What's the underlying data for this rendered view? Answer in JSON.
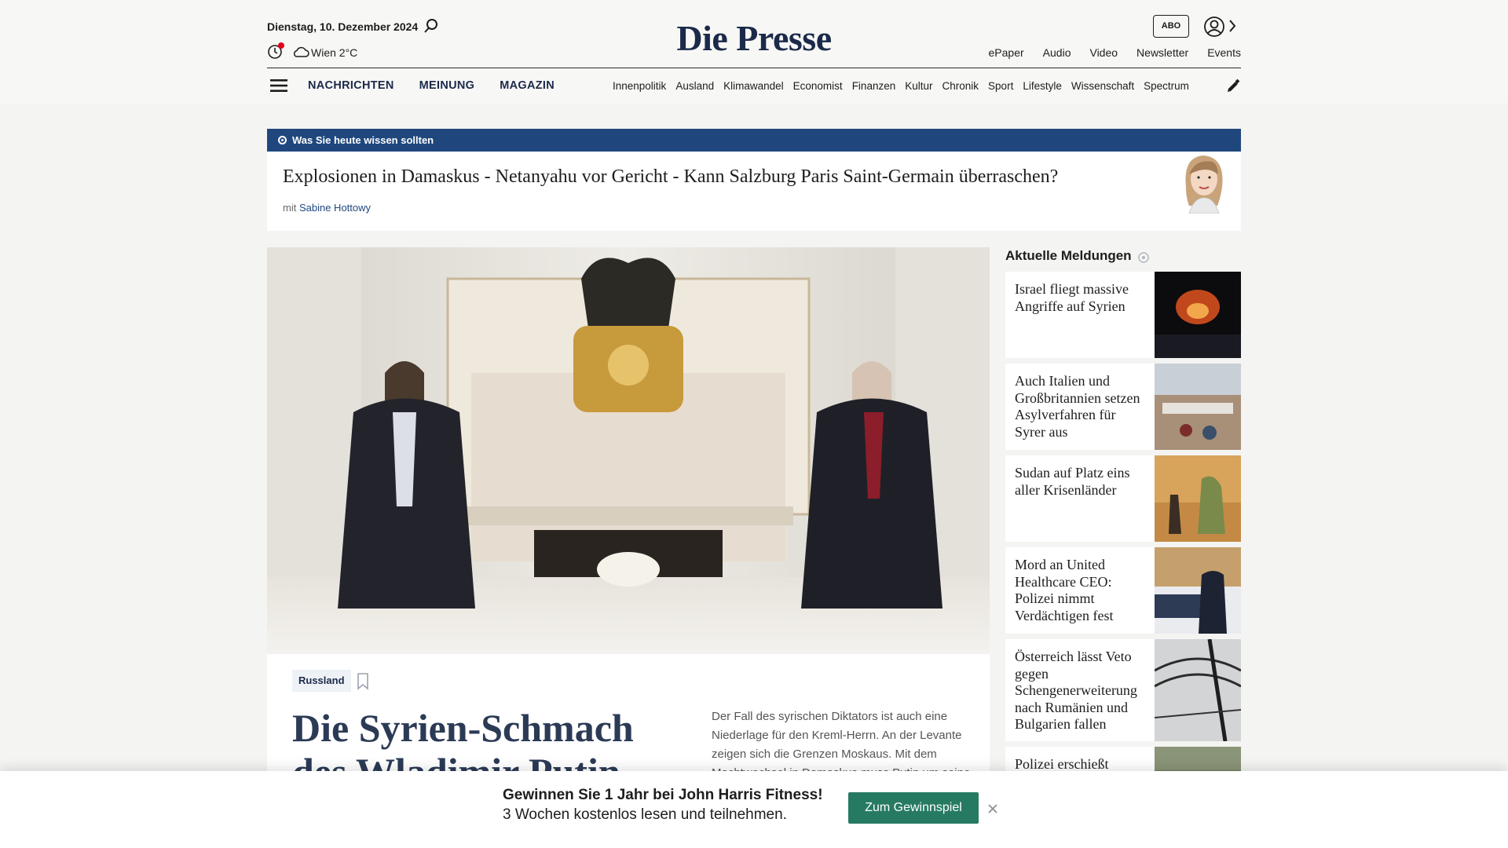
{
  "header": {
    "date": "Dienstag, 10. Dezember 2024",
    "weather": "Wien 2°C",
    "logo": "Die Presse",
    "abo_label": "ABO",
    "top_links": [
      "ePaper",
      "Audio",
      "Video",
      "Newsletter",
      "Events"
    ],
    "main_nav": [
      "NACHRICHTEN",
      "MEINUNG",
      "MAGAZIN"
    ],
    "sub_nav": [
      "Innenpolitik",
      "Ausland",
      "Klimawandel",
      "Economist",
      "Finanzen",
      "Kultur",
      "Chronik",
      "Sport",
      "Lifestyle",
      "Wissenschaft",
      "Spectrum"
    ]
  },
  "briefing": {
    "label": "Was Sie heute wissen sollten",
    "title": "Explosionen in Damaskus - Netanyahu vor Gericht - Kann Salzburg Paris Saint-Germain überraschen?",
    "by_prefix": "mit",
    "author": "Sabine Hottowy"
  },
  "hero": {
    "tag": "Russland",
    "title": "Die Syrien-Schmach des Wladimir Putin",
    "teaser": "Der Fall des syrischen Diktators ist auch eine Niederlage für den Kreml-Herrn. An der Levante zeigen sich die Grenzen Moskaus. Mit dem Machtwechsel in Damaskus muss Putin um seine Stützpunkte bangen."
  },
  "sidebar": {
    "title": "Aktuelle Meldungen",
    "items": [
      {
        "title": "Israel fliegt massive Angriffe auf Syrien"
      },
      {
        "title": "Auch Italien und Großbritannien setzen Asylverfahren für Syrer aus"
      },
      {
        "title": "Sudan auf Platz eins aller Krisenländer"
      },
      {
        "title": "Mord an United Healthcare CEO: Polizei nimmt Verdächtigen fest"
      },
      {
        "title": "Österreich lässt Veto gegen Schengenerweiterung nach Rumänien und Bulgarien fallen"
      },
      {
        "title": "Polizei erschießt"
      }
    ]
  },
  "promo": {
    "line1": "Gewinnen Sie 1 Jahr bei John Harris Fitness!",
    "line2": "3 Wochen kostenlos lesen und teilnehmen.",
    "button": "Zum Gewinnspiel"
  },
  "colors": {
    "brand": "#1b2a4a",
    "briefing_bar": "#1f477e",
    "cta": "#267a62",
    "live_dot": "#e2001a"
  }
}
